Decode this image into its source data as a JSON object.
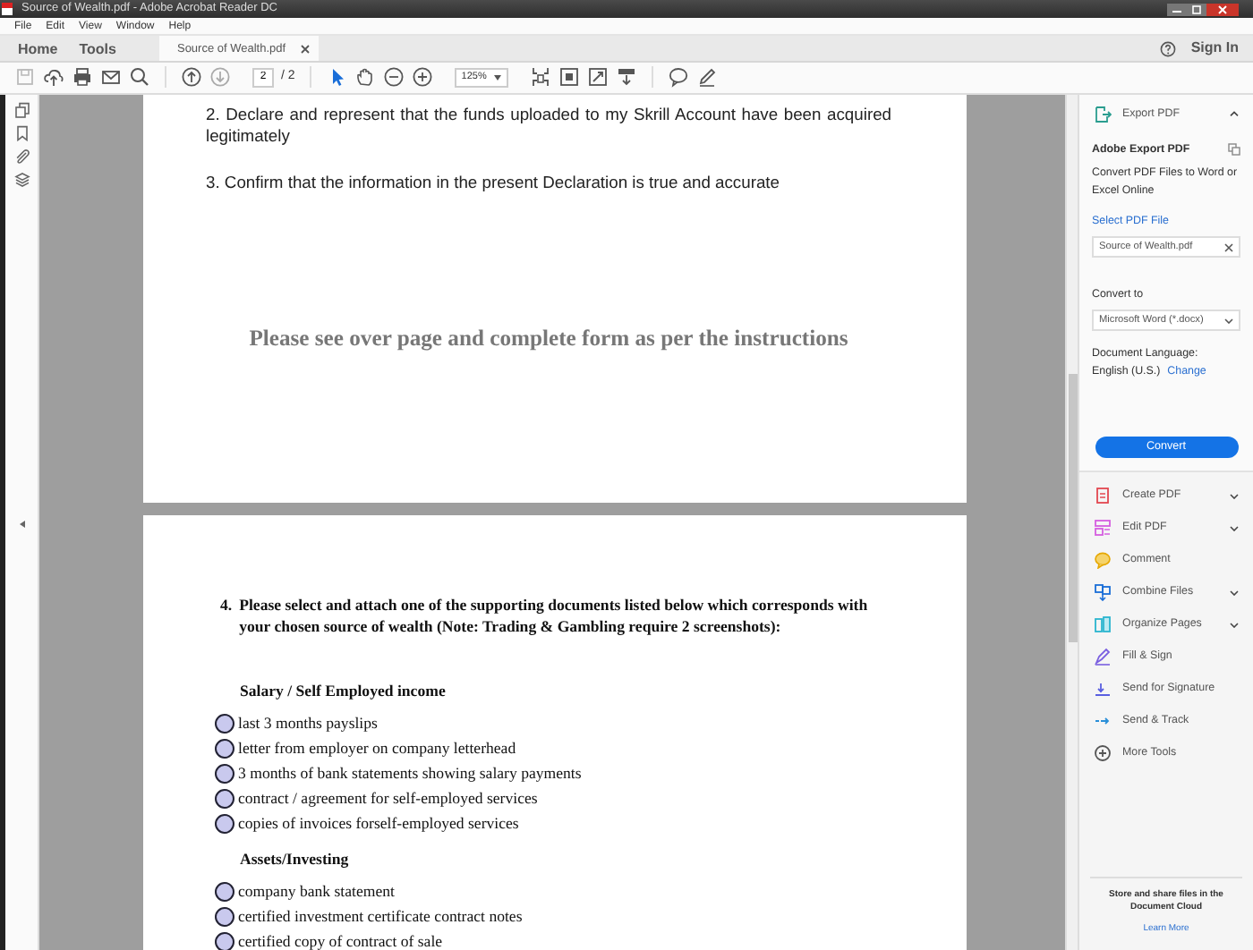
{
  "window": {
    "title": "Source of Wealth.pdf - Adobe Acrobat Reader DC"
  },
  "menu": [
    "File",
    "Edit",
    "View",
    "Window",
    "Help"
  ],
  "tabs": [
    {
      "label": "Home",
      "selected": false
    },
    {
      "label": "Tools",
      "selected": false
    },
    {
      "label": "Source of Wealth.pdf",
      "selected": true,
      "closable": true
    }
  ],
  "account": {
    "sign_in": "Sign In"
  },
  "toolbar": {
    "page": "2",
    "page_total": "/ 2",
    "zoom": "125%"
  },
  "document": {
    "page_1": {
      "items": [
        "2. Declare and represent that the funds uploaded to my Skrill Account have been acquired legitimately",
        "3. Confirm that the information in the present Declaration is true and accurate"
      ],
      "note": "Please see over page and complete form as per the instructions"
    },
    "page_2": {
      "number": "4.",
      "question": "Please select and attach one of the supporting documents listed below which corresponds with your chosen source of wealth (Note: Trading & Gambling require 2 screenshots):",
      "groups": [
        {
          "heading": "Salary / Self Employed income",
          "options": [
            {
              "label": "last 3 months payslips",
              "selected": false
            },
            {
              "label": "letter from employer on company letterhead",
              "selected": false
            },
            {
              "label": "3 months of bank statements showing salary payments",
              "selected": false
            },
            {
              "label": "contract / agreement for self-employed services",
              "selected": false
            },
            {
              "label": "copies of invoices forself-employed services",
              "selected": false
            }
          ]
        },
        {
          "heading": "Assets/Investing",
          "options": [
            {
              "label": "company bank statement",
              "selected": false
            },
            {
              "label": "certified investment certificate contract notes",
              "selected": false
            },
            {
              "label": "certified copy of contract of sale",
              "selected": false
            }
          ]
        }
      ]
    }
  },
  "tools_panel": {
    "export": {
      "title": "Export PDF",
      "expanded": true,
      "heading": "Adobe Export PDF",
      "description": "Convert PDF Files to Word or Excel Online",
      "select_link": "Select PDF File",
      "file": "Source of Wealth.pdf",
      "convert_label": "Convert to",
      "format": "Microsoft Word (*.docx)",
      "language_label": "Document Language:",
      "language": "English (U.S.)",
      "change_link": "Change",
      "button": "Convert"
    },
    "tools": [
      {
        "label": "Create PDF",
        "expandable": true
      },
      {
        "label": "Edit PDF",
        "expandable": true
      },
      {
        "label": "Comment",
        "expandable": false
      },
      {
        "label": "Combine Files",
        "expandable": true
      },
      {
        "label": "Organize Pages",
        "expandable": true
      },
      {
        "label": "Fill & Sign",
        "expandable": false
      },
      {
        "label": "Send for Signature",
        "expandable": false
      },
      {
        "label": "Send & Track",
        "expandable": false
      },
      {
        "label": "More Tools",
        "expandable": false
      }
    ],
    "footer": {
      "text": "Store and share files in the Document Cloud",
      "link": "Learn More"
    }
  }
}
